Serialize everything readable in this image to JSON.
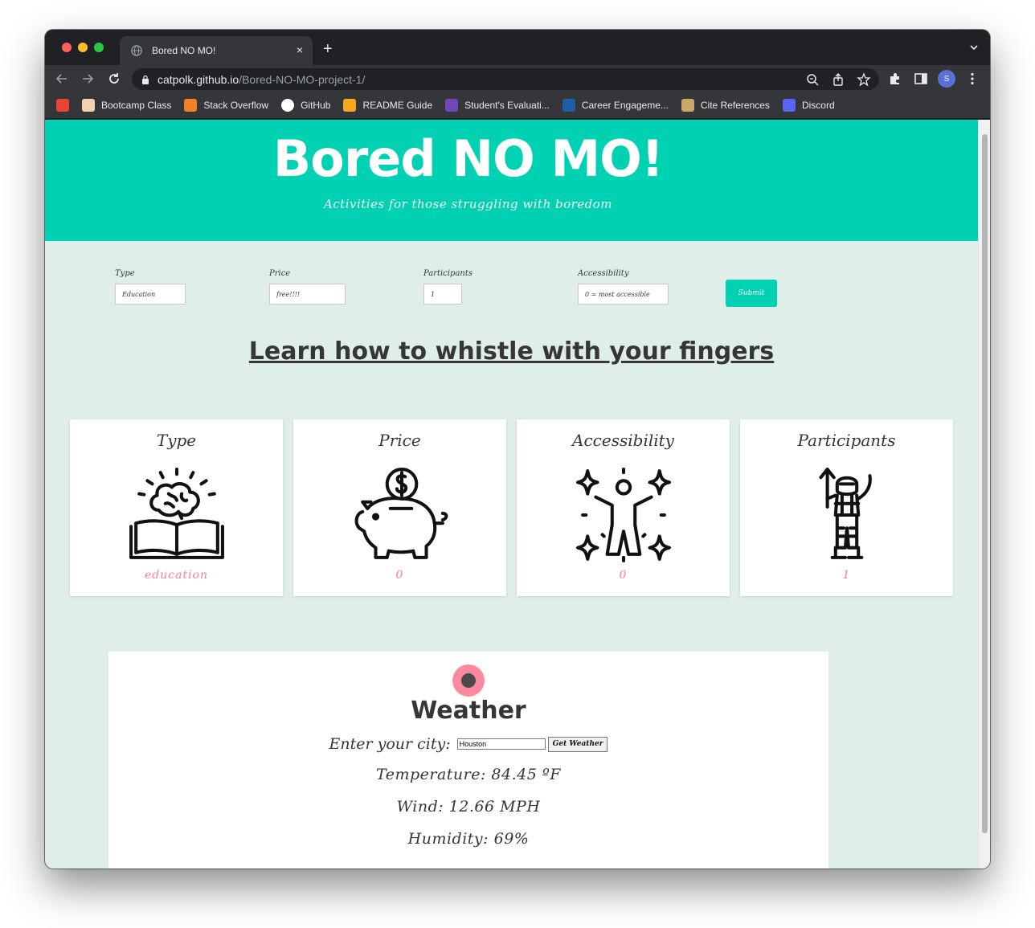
{
  "browser": {
    "tab_title": "Bored NO MO!",
    "tab_close": "×",
    "new_tab": "+",
    "url_host": "catpolk.github.io",
    "url_path": "/Bored-NO-MO-project-1/",
    "profile_initial": "S",
    "bookmarks": [
      {
        "label": "",
        "icon": "gmail-icon",
        "color": "#ea4335"
      },
      {
        "label": "Bootcamp Class",
        "icon": "bootcamp-icon",
        "color": "#f5d0b0"
      },
      {
        "label": "Stack Overflow",
        "icon": "stackoverflow-icon",
        "color": "#f48024"
      },
      {
        "label": "GitHub",
        "icon": "github-icon",
        "color": "#ffffff"
      },
      {
        "label": "README Guide",
        "icon": "readme-icon",
        "color": "#f7a81b"
      },
      {
        "label": "Student's Evaluati...",
        "icon": "forms-icon",
        "color": "#7248b9"
      },
      {
        "label": "Career Engageme...",
        "icon": "career-icon",
        "color": "#1f5fa8"
      },
      {
        "label": "Cite References",
        "icon": "cite-icon",
        "color": "#c9a86a"
      },
      {
        "label": "Discord",
        "icon": "discord-icon",
        "color": "#5865f2"
      }
    ]
  },
  "hero": {
    "title": "Bored NO MO!",
    "subtitle": "Activities for those struggling with boredom"
  },
  "filters": {
    "type_label": "Type",
    "type_value": "Education",
    "price_label": "Price",
    "price_value": "free!!!!",
    "participants_label": "Participants",
    "participants_value": "1",
    "accessibility_label": "Accessibility",
    "accessibility_value": "0 = most accessible",
    "submit_label": "Submit"
  },
  "activity": {
    "title": "Learn how to whistle with your fingers"
  },
  "cards": [
    {
      "title": "Type",
      "value": "education",
      "icon": "brain-book-icon"
    },
    {
      "title": "Price",
      "value": "0",
      "icon": "piggy-bank-icon"
    },
    {
      "title": "Accessibility",
      "value": "0",
      "icon": "sparkle-person-icon"
    },
    {
      "title": "Participants",
      "value": "1",
      "icon": "astronaut-icon"
    }
  ],
  "weather": {
    "title": "Weather",
    "city_label": "Enter your city:",
    "city_value": "Houston",
    "button_label": "Get Weather",
    "temperature": "Temperature: 84.45 ºF",
    "wind": "Wind: 12.66 MPH",
    "humidity": "Humidity: 69%"
  },
  "colors": {
    "hero": "#00d1b2",
    "page_bg": "#dfeee9",
    "card_value": "#ff7c96",
    "weather_icon": "#ff8aa0"
  }
}
